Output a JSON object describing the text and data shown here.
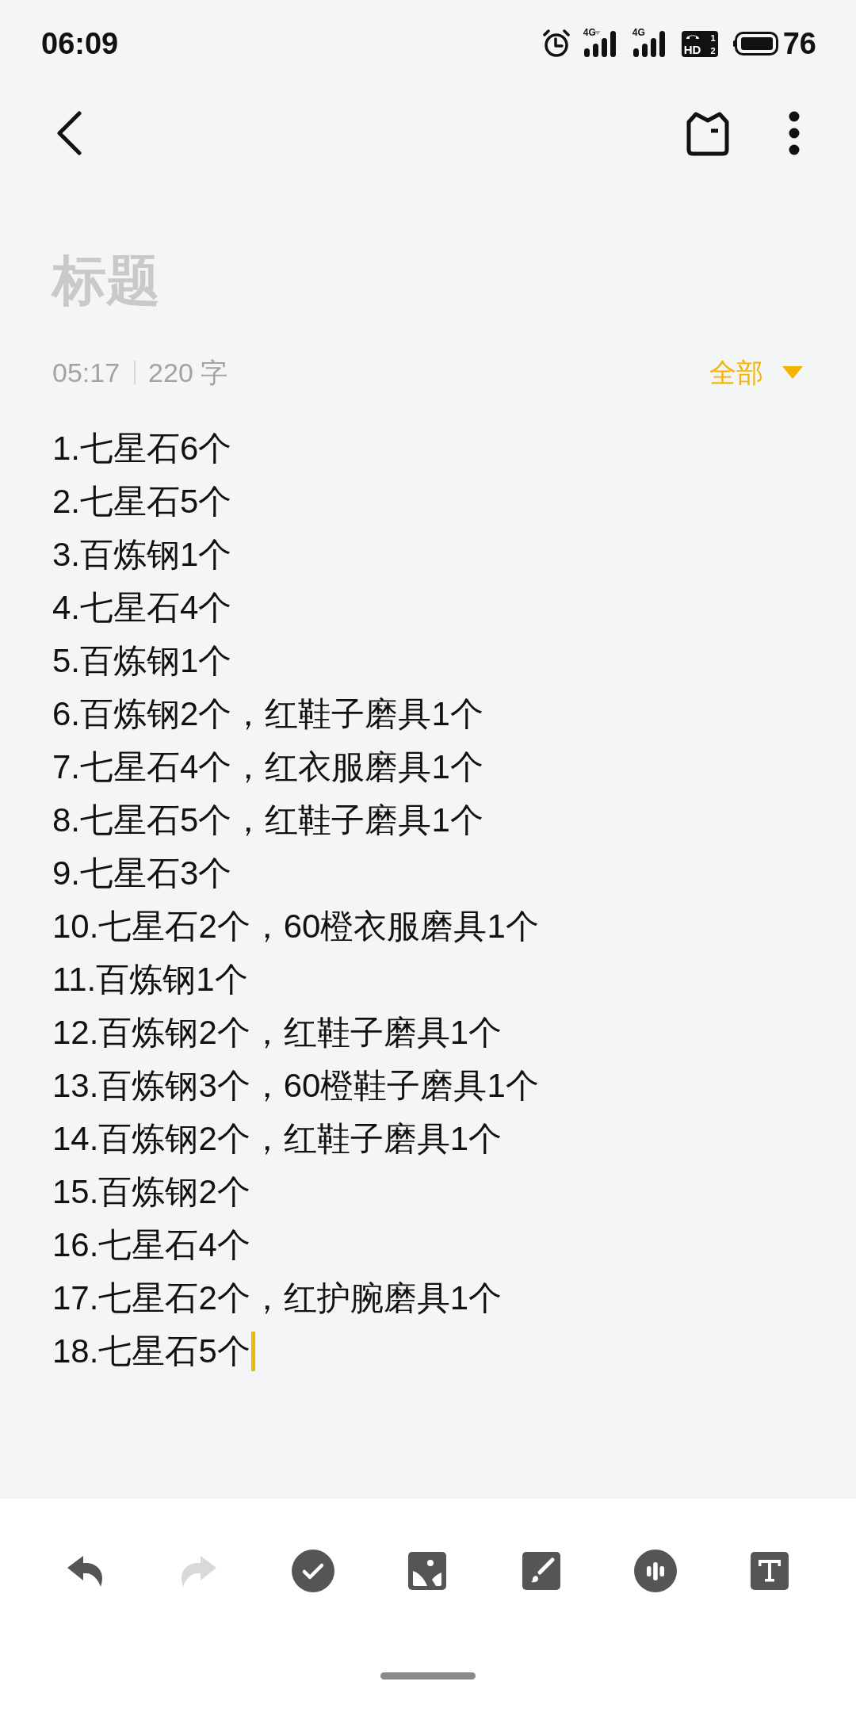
{
  "status_bar": {
    "time": "06:09",
    "networks": [
      {
        "label": "4G"
      },
      {
        "label": "4G"
      }
    ],
    "hd_call": {
      "label": "HD",
      "slots": [
        "1",
        "2"
      ]
    },
    "battery": "76"
  },
  "note": {
    "title": {
      "placeholder": "标题"
    },
    "time": "05:17",
    "word_count": "220 字",
    "filter": "全部",
    "focused": true,
    "lines": [
      "1.七星石6个",
      "2.七星石5个",
      "3.百炼钢1个",
      "4.七星石4个",
      "5.百炼钢1个",
      "6.百炼钢2个，红鞋子磨具1个",
      "7.七星石4个，红衣服磨具1个",
      "8.七星石5个，红鞋子磨具1个",
      "9.七星石3个",
      "10.七星石2个，60橙衣服磨具1个",
      "11.百炼钢1个",
      "12.百炼钢2个，红鞋子磨具1个",
      "13.百炼钢3个，60橙鞋子磨具1个",
      "14.百炼钢2个，红鞋子磨具1个",
      "15.百炼钢2个",
      "16.七星石4个",
      "17.七星石2个，红护腕磨具1个",
      "18.七星石5个"
    ]
  },
  "toolbar": [
    {
      "kind": "undo",
      "disabled": false
    },
    {
      "kind": "redo",
      "disabled": true
    },
    {
      "kind": "checklist",
      "disabled": false
    },
    {
      "kind": "image",
      "disabled": false
    },
    {
      "kind": "brush",
      "disabled": false
    },
    {
      "kind": "audio",
      "disabled": false
    },
    {
      "kind": "text",
      "disabled": false
    }
  ]
}
